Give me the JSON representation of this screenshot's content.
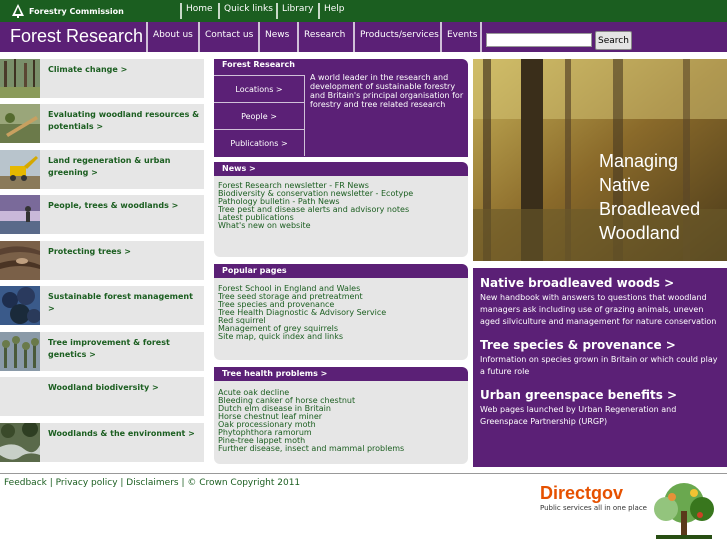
{
  "top_bar": {
    "logo_text": "Forestry Commission",
    "links": [
      "Home",
      "Quick links",
      "Library",
      "Help"
    ]
  },
  "header": {
    "site_title": "Forest Research",
    "nav": [
      "About us",
      "Contact us",
      "News",
      "Research",
      "Products/services",
      "Events"
    ],
    "search_placeholder": "",
    "search_button": "Search"
  },
  "topics": [
    {
      "label": "Climate change >",
      "icon": "forest-photo-icon"
    },
    {
      "label": "Evaluating woodland resources & potentials >",
      "icon": "measuring-photo-icon"
    },
    {
      "label": "Land regeneration & urban greening >",
      "icon": "machinery-photo-icon"
    },
    {
      "label": "People, trees & woodlands >",
      "icon": "people-photo-icon"
    },
    {
      "label": "Protecting trees >",
      "icon": "bark-photo-icon"
    },
    {
      "label": "Sustainable forest management >",
      "icon": "foliage-photo-icon"
    },
    {
      "label": "Tree improvement & forest genetics >",
      "icon": "seedlings-photo-icon"
    },
    {
      "label": "Woodland biodiversity >",
      "icon": ""
    },
    {
      "label": "Woodlands & the environment >",
      "icon": "stream-photo-icon"
    }
  ],
  "forest_research_box": {
    "title": "Forest Research",
    "links": [
      "Locations >",
      "People >",
      "Publications >"
    ],
    "description": "A world leader in the research and development of sustainable forestry and Britain's principal organisation for forestry and tree related research"
  },
  "news": {
    "title": "News >",
    "items": [
      "Forest Research newsletter - FR News",
      "Biodiversity & conservation newsletter - Ecotype",
      "Pathology bulletin - Path News",
      "Tree pest and disease alerts and advisory notes",
      "Latest publications",
      "What's new on website"
    ]
  },
  "popular": {
    "title": "Popular pages",
    "items": [
      "Forest School in England and Wales",
      "Tree seed storage and pretreatment",
      "Tree species and provenance",
      "Tree Health Diagnostic & Advisory Service",
      "Red squirrel",
      "Management of grey squirrels",
      "Site map, quick index and links"
    ]
  },
  "tree_health": {
    "title": "Tree health problems >",
    "items": [
      "Acute oak decline",
      "Bleeding canker of horse chestnut",
      "Dutch elm disease in Britain",
      "Horse chestnut leaf miner",
      "Oak processionary moth",
      "Phytophthora ramorum",
      "Pine-tree lappet moth",
      "Further disease, insect and mammal problems"
    ]
  },
  "hero": {
    "lines": [
      "Managing",
      "Native",
      "Broadleaved",
      "Woodland"
    ]
  },
  "features": [
    {
      "heading": "Native broadleaved woods >",
      "body": "New handbook with answers to questions that woodland managers ask including use of grazing animals, uneven aged silviculture and management for nature conservation"
    },
    {
      "heading": "Tree species & provenance >",
      "body": "Information on species grown in Britain or which could play a future role"
    },
    {
      "heading": "Urban greenspace benefits >",
      "body": "Web pages launched by Urban Regeneration and Greenspace Partnership (URGP)"
    }
  ],
  "footer": {
    "links": "Feedback | Privacy policy | Disclaimers | © Crown Copyright 2011",
    "directgov": "Directgov",
    "directgov_tagline": "Public services all in one place"
  },
  "colors": {
    "purple": "#5b2076",
    "green": "#1b5e20",
    "panel": "#e6e6e6",
    "directgov_orange": "#e65100"
  }
}
